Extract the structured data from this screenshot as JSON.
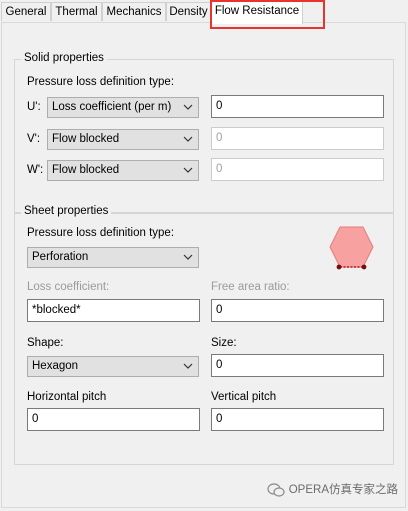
{
  "tabs": [
    "General",
    "Thermal",
    "Mechanics",
    "Density",
    "Flow Resistance"
  ],
  "active_tab_index": 4,
  "solid": {
    "title": "Solid properties",
    "loss_type_label": "Pressure loss definition type:",
    "rows": [
      {
        "axis": "U':",
        "mode": "Loss coefficient (per m)",
        "value": "0",
        "enabled": true
      },
      {
        "axis": "V':",
        "mode": "Flow blocked",
        "value": "0",
        "enabled": false
      },
      {
        "axis": "W':",
        "mode": "Flow blocked",
        "value": "0",
        "enabled": false
      }
    ]
  },
  "sheet": {
    "title": "Sheet properties",
    "loss_type_label": "Pressure loss definition type:",
    "loss_type": "Perforation",
    "loss_coefficient_label": "Loss coefficient:",
    "loss_coefficient_value": "*blocked*",
    "free_area_label": "Free area ratio:",
    "free_area_value": "0",
    "shape_label": "Shape:",
    "shape_value": "Hexagon",
    "size_label": "Size:",
    "size_value": "0",
    "hpitch_label": "Horizontal pitch",
    "hpitch_value": "0",
    "vpitch_label": "Vertical pitch",
    "vpitch_value": "0"
  },
  "icons": {
    "combo_arrow": "chevron-down-icon",
    "shape_preview": "hexagon-icon",
    "watermark_logo": "wechat-icon"
  },
  "colors": {
    "hexagon_fill": "#f7a1a1",
    "hexagon_stroke": "#e57b7b",
    "highlight": "#e8332e"
  },
  "watermark": "OPERA仿真专家之路"
}
